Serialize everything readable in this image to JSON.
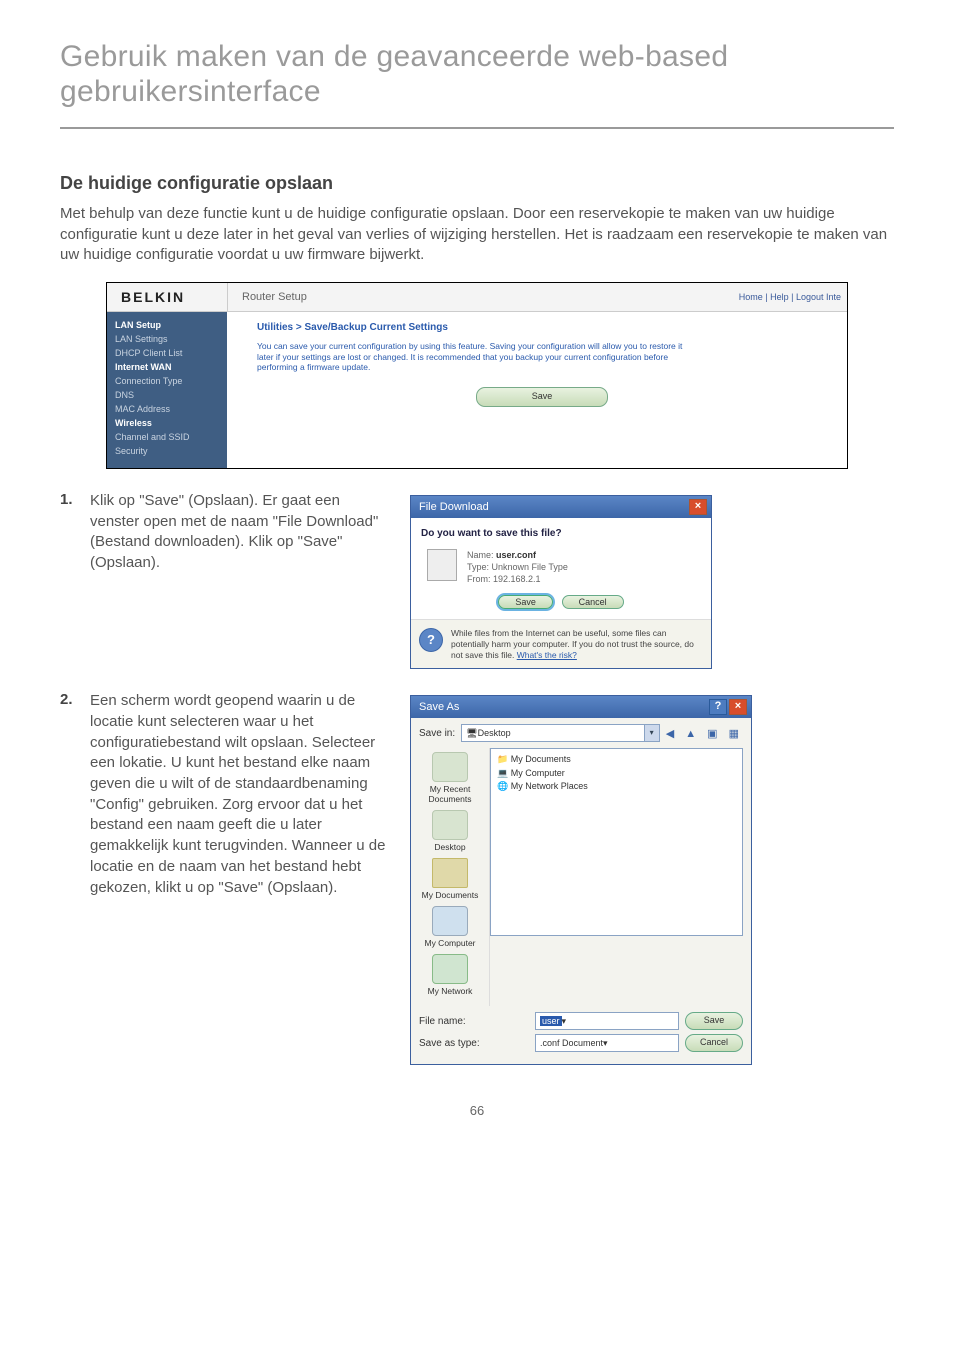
{
  "page": {
    "title": "Gebruik maken van de geavanceerde web-based gebruikersinterface",
    "section_heading": "De huidige configuratie opslaan",
    "intro": "Met behulp van deze functie kunt u de huidige configuratie opslaan. Door een reservekopie te maken van uw huidige configuratie kunt u deze later in het geval van verlies of wijziging herstellen. Het is raadzaam een reservekopie te maken van uw huidige configuratie voordat u uw firmware bijwerkt.",
    "page_number": "66"
  },
  "router": {
    "logo": "BELKIN",
    "title": "Router Setup",
    "links": "Home | Help | Logout   Inte",
    "sidebar": {
      "hdr1": "LAN Setup",
      "items1": [
        "LAN Settings",
        "DHCP Client List"
      ],
      "hdr2": "Internet WAN",
      "items2": [
        "Connection Type",
        "DNS",
        "MAC Address"
      ],
      "hdr3": "Wireless",
      "items3": [
        "Channel and SSID",
        "Security"
      ]
    },
    "crumb": "Utilities > Save/Backup Current Settings",
    "desc": "You can save your current configuration by using this feature. Saving your configuration will allow you to restore it later if your settings are lost or changed. It is recommended that you backup your current configuration before performing a firmware update.",
    "save_btn": "Save"
  },
  "steps": {
    "s1_num": "1.",
    "s1_text": "Klik op \"Save\" (Opslaan). Er gaat een venster open met de naam \"File Download\" (Bestand downloaden). Klik op \"Save\" (Opslaan).",
    "s2_num": "2.",
    "s2_text": "Een scherm wordt geopend waarin u de locatie kunt selecteren waar u het configuratiebestand wilt opslaan. Selecteer een lokatie. U kunt het bestand elke naam geven die u wilt of de standaardbenaming \"Config\" gebruiken. Zorg ervoor dat u het bestand een naam geeft die u later gemakkelijk kunt terugvinden. Wanneer u de locatie en de naam van het bestand hebt gekozen, klikt u op \"Save\" (Opslaan)."
  },
  "dl": {
    "title": "File Download",
    "question": "Do you want to save this file?",
    "name_lbl": "Name:",
    "name_val": "user.conf",
    "type_lbl": "Type:",
    "type_val": "Unknown File Type",
    "from_lbl": "From:",
    "from_val": "192.168.2.1",
    "save_btn": "Save",
    "cancel_btn": "Cancel",
    "warn": "While files from the Internet can be useful, some files can potentially harm your computer. If you do not trust the source, do not save this file.",
    "warn_link": "What's the risk?"
  },
  "saveas": {
    "title": "Save As",
    "savein_lbl": "Save in:",
    "savein_val": "Desktop",
    "places": {
      "recent": "My Recent Documents",
      "desktop": "Desktop",
      "docs": "My Documents",
      "comp": "My Computer",
      "net": "My Network"
    },
    "listing": [
      "My Documents",
      "My Computer",
      "My Network Places"
    ],
    "filename_lbl": "File name:",
    "filename_val": "user",
    "saveas_lbl": "Save as type:",
    "saveas_val": ".conf Document",
    "save_btn": "Save",
    "cancel_btn": "Cancel"
  }
}
